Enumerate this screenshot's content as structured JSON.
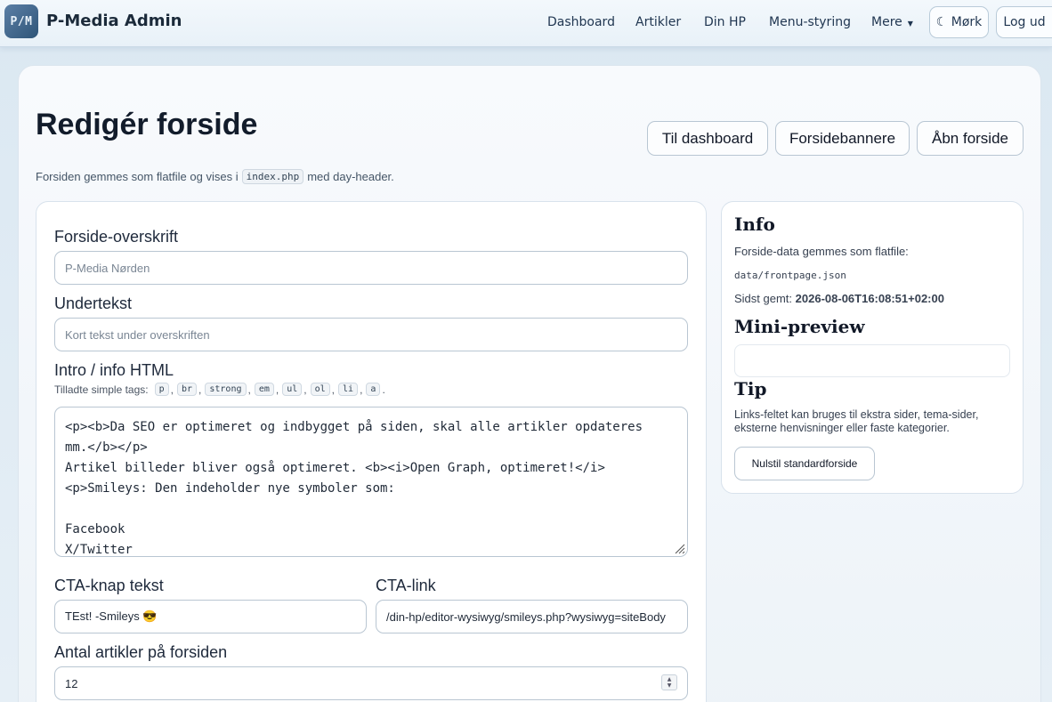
{
  "app": {
    "logo_text": "P/M",
    "brand": "P-Media Admin"
  },
  "nav": {
    "links": [
      "Dashboard",
      "Artikler",
      "Din HP",
      "Menu-styring",
      "Mere"
    ],
    "theme_button": "☾ Mørk",
    "logout_button": "Log ud"
  },
  "page": {
    "title": "Redigér forside",
    "subtitle_before": "Forsiden gemmes som flatfile og vises i",
    "subtitle_code": "index.php",
    "subtitle_after": "med day-header.",
    "buttons": {
      "dashboard": "Til dashboard",
      "banners": "Forsidebannere",
      "open": "Åbn forside"
    }
  },
  "form": {
    "headline_label": "Forside-overskrift",
    "headline_placeholder": "P-Media Nørden",
    "subtext_label": "Undertekst",
    "subtext_placeholder": "Kort tekst under overskriften",
    "intro_label": "Intro / info HTML",
    "tags_prefix": "Tilladte simple tags:",
    "tags": [
      "p",
      "br",
      "strong",
      "em",
      "ul",
      "ol",
      "li",
      "a"
    ],
    "intro_lines": [
      "<p><b>Da SEO er optimeret og indbygget på siden, skal alle artikler opdateres",
      "mm.</b></p>",
      "Artikel billeder bliver også optimeret. <b><i>Open Graph, optimeret!</i>",
      "<p>Smileys: Den indeholder nye symboler som:",
      "",
      "Facebook",
      "X/Twitter"
    ],
    "cta_text_label": "CTA-knap tekst",
    "cta_text_value": "TEst! -Smileys 😎",
    "cta_link_label": "CTA-link",
    "cta_link_value": "/din-hp/editor-wysiwyg/smileys.php?wysiwyg=siteBody",
    "count_label": "Antal artikler på forsiden",
    "count_value": "12"
  },
  "info": {
    "heading": "Info",
    "flatfile_text": "Forside-data gemmes som flatfile:",
    "flatfile_path": "data/frontpage.json",
    "saved_label": "Sidst gemt:",
    "saved_value": "2026-08-06T16:08:51+02:00",
    "preview_heading": "Mini-preview",
    "tip_heading": "Tip",
    "tip_line1": "Links-feltet kan bruges til ekstra sider, tema-sider,",
    "tip_line2": "eksterne henvisninger eller faste kategorier.",
    "reset_button": "Nulstil standardforside"
  }
}
